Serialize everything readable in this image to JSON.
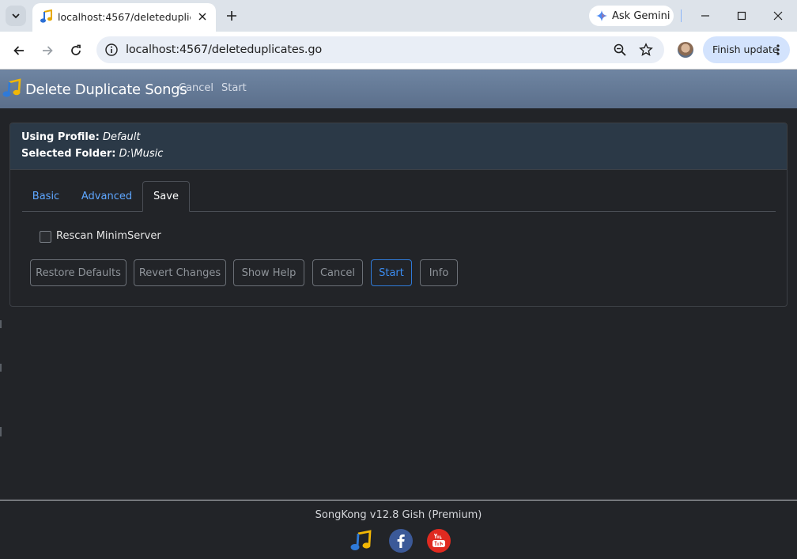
{
  "browser": {
    "tab_title": "localhost:4567/deleteduplicates",
    "url": "localhost:4567/deleteduplicates.go",
    "gemini_label": "Ask Gemini",
    "finish_update_label": "Finish update"
  },
  "app": {
    "title": "Delete Duplicate Songs",
    "header_links": {
      "cancel": "Cancel",
      "start": "Start"
    }
  },
  "profile": {
    "profile_label": "Using Profile:",
    "profile_value": "Default",
    "folder_label": "Selected Folder:",
    "folder_value": "D:\\Music"
  },
  "tabs": [
    {
      "label": "Basic",
      "active": false
    },
    {
      "label": "Advanced",
      "active": false
    },
    {
      "label": "Save",
      "active": true
    }
  ],
  "options": {
    "rescan_label": "Rescan MinimServer",
    "rescan_checked": false
  },
  "buttons": {
    "restore_defaults": "Restore Defaults",
    "revert_changes": "Revert Changes",
    "show_help": "Show Help",
    "cancel": "Cancel",
    "start": "Start",
    "info": "Info"
  },
  "footer": {
    "version_text": "SongKong v12.8 Gish (Premium)"
  },
  "icons": {
    "tab_favicon": "songkong-note-icon",
    "footer": [
      "songkong-note-icon",
      "facebook-icon",
      "youtube-icon"
    ]
  },
  "colors": {
    "accent_blue": "#3b8cf0",
    "header_bg": "#5b6f8b",
    "page_bg": "#222428"
  }
}
